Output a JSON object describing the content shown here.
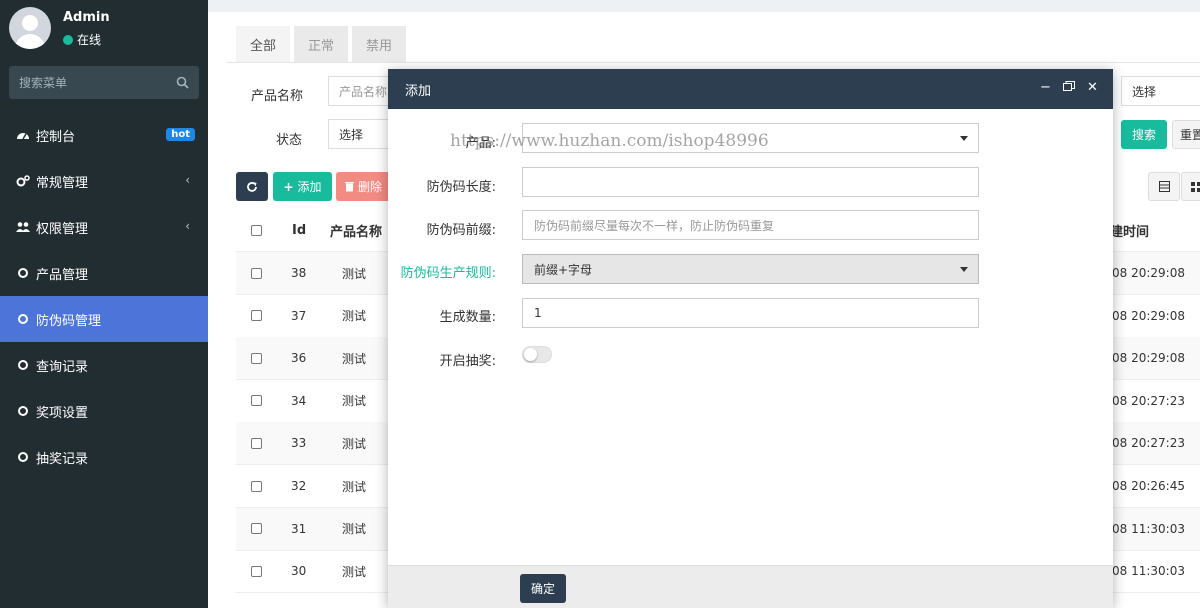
{
  "user": {
    "name": "Admin",
    "status": "在线"
  },
  "sidebar": {
    "search_placeholder": "搜索菜单",
    "items": [
      {
        "label": "控制台",
        "icon": "dashboard-icon",
        "badge": "hot"
      },
      {
        "label": "常规管理",
        "icon": "cogs-icon"
      },
      {
        "label": "权限管理",
        "icon": "users-icon"
      },
      {
        "label": "产品管理",
        "icon": "circle-icon"
      },
      {
        "label": "防伪码管理",
        "icon": "circle-icon",
        "active": true
      },
      {
        "label": "查询记录",
        "icon": "circle-icon"
      },
      {
        "label": "奖项设置",
        "icon": "circle-icon"
      },
      {
        "label": "抽奖记录",
        "icon": "circle-icon"
      }
    ]
  },
  "tabs": [
    "全部",
    "正常",
    "禁用"
  ],
  "filters": {
    "product_label": "产品名称",
    "product_placeholder": "产品名称",
    "status_label": "状态",
    "status_value": "选择",
    "right_select": "选择",
    "search_btn": "搜索",
    "reset_btn": "重置"
  },
  "toolbar": {
    "add_label": "添加",
    "delete_label": "删除"
  },
  "table": {
    "headers": {
      "id": "Id",
      "name": "产品名称",
      "time": "建时间"
    },
    "rows": [
      {
        "id": "38",
        "name": "测试",
        "time": "08 20:29:08"
      },
      {
        "id": "37",
        "name": "测试",
        "time": "08 20:29:08"
      },
      {
        "id": "36",
        "name": "测试",
        "time": "08 20:29:08"
      },
      {
        "id": "34",
        "name": "测试",
        "time": "08 20:27:23"
      },
      {
        "id": "33",
        "name": "测试",
        "time": "08 20:27:23"
      },
      {
        "id": "32",
        "name": "测试",
        "time": "08 20:26:45"
      },
      {
        "id": "31",
        "name": "测试",
        "time": "08 11:30:03"
      },
      {
        "id": "30",
        "name": "测试",
        "time": "08 11:30:03"
      }
    ]
  },
  "modal": {
    "title": "添加",
    "watermark": "https://www.huzhan.com/ishop48996",
    "fields": {
      "product_label": "产品:",
      "length_label": "防伪码长度:",
      "prefix_label": "防伪码前缀:",
      "prefix_placeholder": "防伪码前缀尽量每次不一样，防止防伪码重复",
      "rule_label": "防伪码生产规则:",
      "rule_value": "前缀+字母",
      "count_label": "生成数量:",
      "count_value": "1",
      "lottery_label": "开启抽奖:",
      "lottery_enabled": false
    },
    "ok_label": "确定"
  },
  "colors": {
    "sidebar_bg": "#222d32",
    "active_blue": "#4d74d8",
    "teal": "#18bc9c",
    "modal_header": "#2c3e50",
    "delete_red": "#f28b82"
  }
}
